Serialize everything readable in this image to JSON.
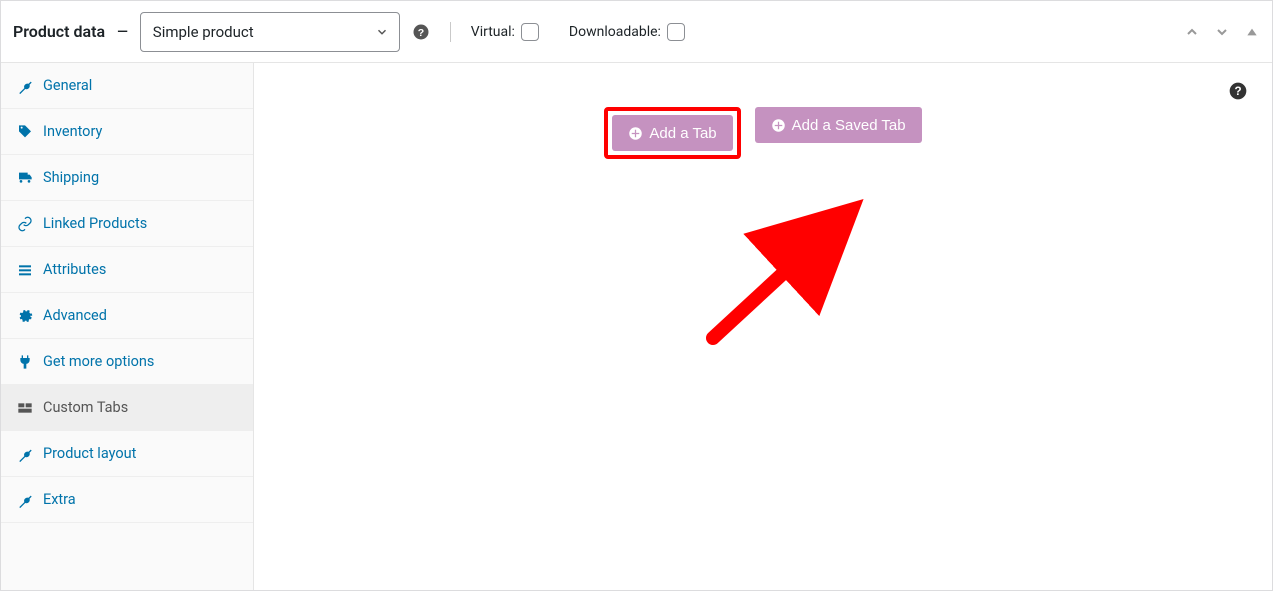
{
  "header": {
    "title": "Product data",
    "dash": "—",
    "product_type_selected": "Simple product",
    "virtual_label": "Virtual:",
    "downloadable_label": "Downloadable:"
  },
  "sidebar": {
    "items": [
      {
        "label": "General",
        "icon": "wrench"
      },
      {
        "label": "Inventory",
        "icon": "tag"
      },
      {
        "label": "Shipping",
        "icon": "truck"
      },
      {
        "label": "Linked Products",
        "icon": "link"
      },
      {
        "label": "Attributes",
        "icon": "list"
      },
      {
        "label": "Advanced",
        "icon": "gear"
      },
      {
        "label": "Get more options",
        "icon": "plug"
      },
      {
        "label": "Custom Tabs",
        "icon": "tabs",
        "active": true
      },
      {
        "label": "Product layout",
        "icon": "wrench"
      },
      {
        "label": "Extra",
        "icon": "wrench"
      }
    ]
  },
  "content": {
    "add_tab_label": "Add a Tab",
    "add_saved_tab_label": "Add a Saved Tab"
  }
}
